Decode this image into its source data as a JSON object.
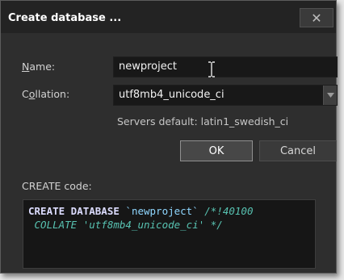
{
  "dialog": {
    "title": "Create database ...",
    "close_label": "✕"
  },
  "form": {
    "name_label_accel": "N",
    "name_label_rest": "ame:",
    "name_value": "newproject",
    "collation_label_pre": "C",
    "collation_label_accel": "o",
    "collation_label_rest": "llation:",
    "collation_value": "utf8mb4_unicode_ci",
    "servers_default": "Servers default: latin1_swedish_ci"
  },
  "buttons": {
    "ok": "OK",
    "cancel": "Cancel"
  },
  "code": {
    "label": "CREATE code:",
    "line1_kw": "CREATE DATABASE",
    "line1_ident": "`newproject`",
    "line1_cmt": "/*!40100",
    "line2_cmt": " COLLATE 'utf8mb4_unicode_ci' */"
  },
  "colors": {
    "dialog_bg": "#2e2e2e",
    "titlebar_bg": "#232323",
    "field_bg": "#181818",
    "keyword": "#dcdcff",
    "identifier": "#8fd7ff",
    "comment": "#58c3b2"
  },
  "icons": {
    "close": "close-icon",
    "text_cursor": "text-cursor-icon",
    "dropdown": "chevron-down-icon"
  }
}
